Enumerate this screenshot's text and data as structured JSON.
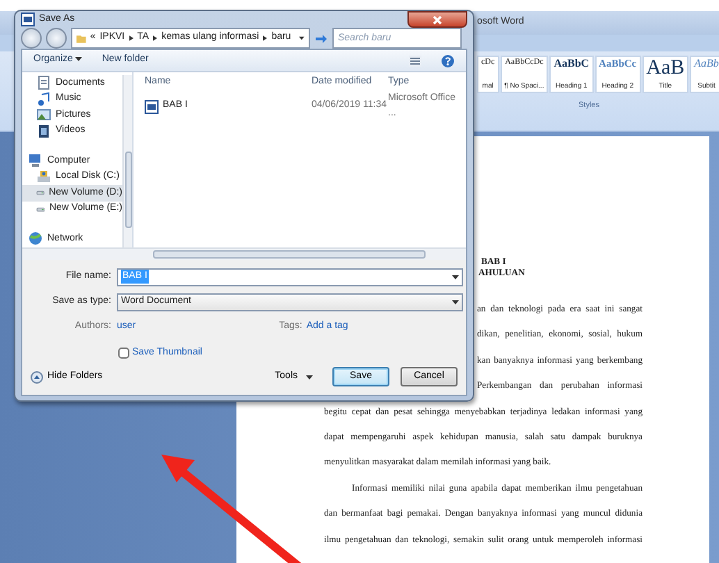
{
  "word": {
    "title": "osoft Word",
    "styles": [
      {
        "sample": "cDc",
        "name": "mal",
        "kind": "normal"
      },
      {
        "sample": "AaBbCcDc",
        "name": "¶ No Spaci...",
        "kind": "normal"
      },
      {
        "sample": "AaBbC",
        "name": "Heading 1",
        "kind": "heading1"
      },
      {
        "sample": "AaBbCc",
        "name": "Heading 2",
        "kind": "heading2"
      },
      {
        "sample": "AaB",
        "name": "Title",
        "kind": "title"
      },
      {
        "sample": "AaBb",
        "name": "Subtit",
        "kind": "subtitle"
      }
    ],
    "styles_group": "Styles",
    "document": [
      {
        "kind": "heading",
        "text": "BAB I"
      },
      {
        "kind": "heading_partial",
        "text": "AHULUAN"
      },
      {
        "kind": "gap"
      },
      {
        "kind": "partial",
        "text": "an dan teknologi pada era saat ini sangat"
      },
      {
        "kind": "partial",
        "text": "dikan, penelitian, ekonomi, sosial, hukum"
      },
      {
        "kind": "partial",
        "text": "kan banyaknya informasi yang berkembang"
      },
      {
        "kind": "partial",
        "text": "Perkembangan dan perubahan informasi"
      },
      {
        "kind": "full",
        "text": "begitu cepat dan pesat sehingga menyebabkan terjadinya ledakan informasi yang"
      },
      {
        "kind": "full",
        "text": "dapat mempengaruhi aspek kehidupan manusia, salah satu dampak buruknya"
      },
      {
        "kind": "last",
        "text": "menyulitkan masyarakat dalam memilah informasi yang baik."
      },
      {
        "kind": "indent",
        "text": "Informasi memiliki nilai guna apabila dapat memberikan ilmu pengetahuan"
      },
      {
        "kind": "full",
        "text": "dan bermanfaat bagi pemakai. Dengan banyaknya informasi yang muncul didunia"
      },
      {
        "kind": "full",
        "text": "ilmu pengetahuan dan teknologi, semakin sulit orang untuk memperoleh informasi"
      }
    ]
  },
  "dialog": {
    "title": "Save As",
    "overflow_mark": "«",
    "breadcrumb": [
      "IPKVI",
      "TA",
      "kemas ulang informasi",
      "baru"
    ],
    "search": {
      "placeholder": "Search baru"
    },
    "toolbar": [
      {
        "label": "Organize",
        "dropdown": true
      },
      {
        "label": "New folder",
        "dropdown": false
      }
    ],
    "nav": [
      {
        "items": [
          {
            "label": "Documents",
            "kind": "document",
            "selected": false
          },
          {
            "label": "Music",
            "kind": "music",
            "selected": false
          },
          {
            "label": "Pictures",
            "kind": "pictures",
            "selected": false
          },
          {
            "label": "Videos",
            "kind": "video",
            "selected": false
          }
        ]
      },
      {
        "label": "Computer",
        "kind": "computer",
        "items": [
          {
            "label": "Local Disk (C:)",
            "kind": "disk",
            "selected": false
          },
          {
            "label": "New Volume (D:)",
            "kind": "drive",
            "selected": true
          },
          {
            "label": "New Volume (E:)",
            "kind": "drive",
            "selected": false
          }
        ]
      },
      {
        "label": "Network",
        "kind": "network"
      }
    ],
    "columns": [
      "Name",
      "Date modified",
      "Type"
    ],
    "files": [
      {
        "name": "BAB I",
        "date": "04/06/2019 11:34",
        "type": "Microsoft Office ..."
      }
    ],
    "file_name": {
      "label": "File name:",
      "value": "BAB I",
      "highlighted": true
    },
    "save_as_type": {
      "label": "Save as type:",
      "value": "Word Document"
    },
    "authors": {
      "label": "Authors:",
      "value": "user"
    },
    "tags": {
      "label": "Tags:",
      "value": "Add a tag"
    },
    "save_thumbnail": {
      "label": "Save Thumbnail",
      "checked": false
    },
    "hide_folders": "Hide Folders",
    "tools": "Tools",
    "buttons": [
      {
        "label": "Save",
        "default": true
      },
      {
        "label": "Cancel",
        "default": false
      }
    ]
  }
}
